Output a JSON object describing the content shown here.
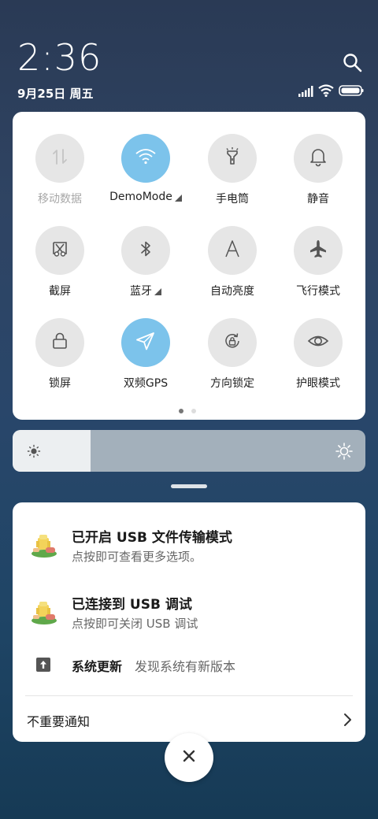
{
  "status_bar": {
    "time": "2:36",
    "date": "9月25日 周五",
    "icons": [
      "search-icon",
      "signal-icon",
      "wifi-icon",
      "battery-icon"
    ]
  },
  "quick_settings": {
    "tiles": [
      {
        "label": "移动数据",
        "icon": "mobile-data-icon",
        "state": "disabled",
        "expandable": false
      },
      {
        "label": "DemoMode",
        "icon": "wifi-icon",
        "state": "on",
        "expandable": true
      },
      {
        "label": "手电筒",
        "icon": "flashlight-icon",
        "state": "off",
        "expandable": false
      },
      {
        "label": "静音",
        "icon": "bell-icon",
        "state": "off",
        "expandable": false
      },
      {
        "label": "截屏",
        "icon": "screenshot-icon",
        "state": "off",
        "expandable": false
      },
      {
        "label": "蓝牙",
        "icon": "bluetooth-icon",
        "state": "off",
        "expandable": true
      },
      {
        "label": "自动亮度",
        "icon": "auto-brightness-icon",
        "state": "off",
        "expandable": false
      },
      {
        "label": "飞行模式",
        "icon": "airplane-icon",
        "state": "off",
        "expandable": false
      },
      {
        "label": "锁屏",
        "icon": "lock-icon",
        "state": "off",
        "expandable": false
      },
      {
        "label": "双频GPS",
        "icon": "gps-icon",
        "state": "on",
        "expandable": false
      },
      {
        "label": "方向锁定",
        "icon": "rotation-lock-icon",
        "state": "off",
        "expandable": false
      },
      {
        "label": "护眼模式",
        "icon": "eye-icon",
        "state": "off",
        "expandable": false
      }
    ],
    "page_count": 2,
    "active_page": 1
  },
  "brightness": {
    "level": 0.22
  },
  "notifications": [
    {
      "title": "已开启 USB 文件传输模式",
      "text": "点按即可查看更多选项。",
      "icon": "android-debug-icon"
    },
    {
      "title": "已连接到 USB 调试",
      "text": "点按即可关闭 USB 调试",
      "icon": "android-debug-icon"
    }
  ],
  "system_update": {
    "title": "系统更新",
    "text": "发现系统有新版本",
    "icon": "upload-icon"
  },
  "unimportant": {
    "label": "不重要通知"
  },
  "colors": {
    "tile_on": "#7cc3eb",
    "tile_off": "#e6e6e6"
  }
}
